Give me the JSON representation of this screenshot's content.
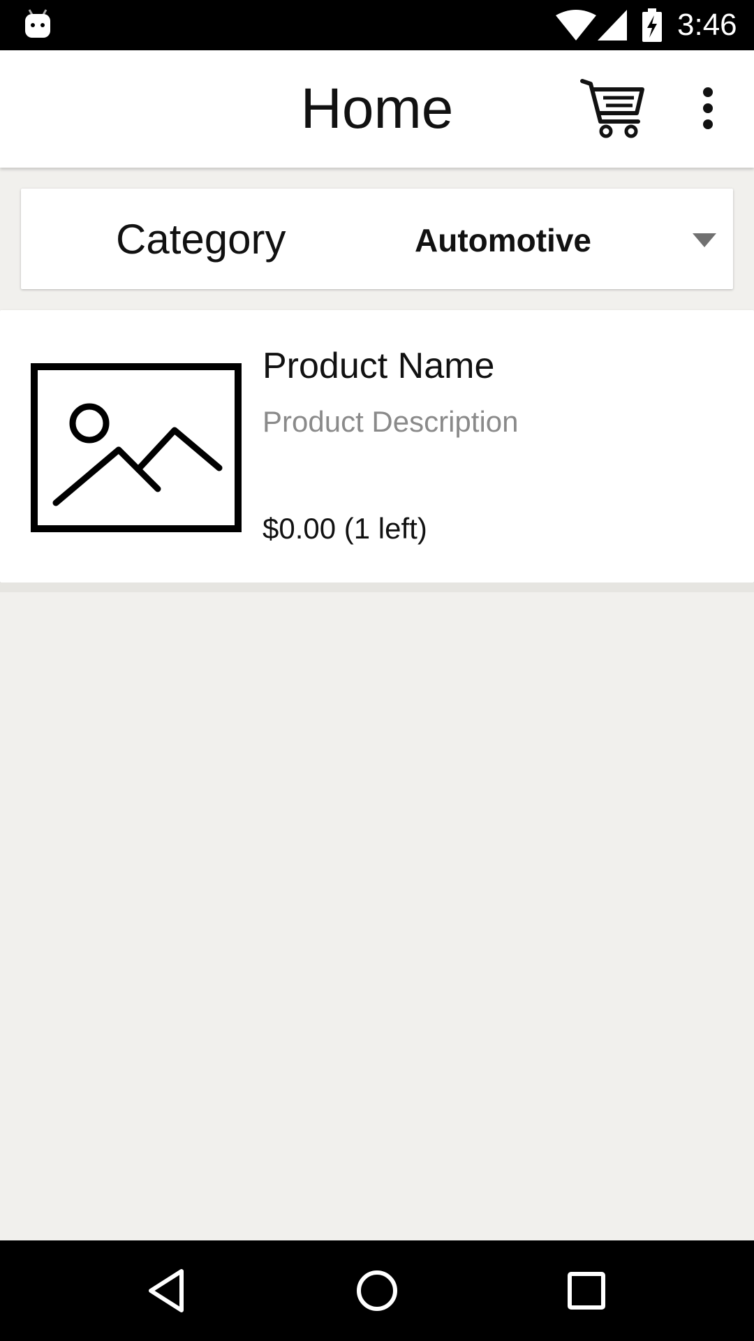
{
  "status_bar": {
    "time": "3:46",
    "icons": [
      "android-icon",
      "wifi-icon",
      "signal-icon",
      "battery-charging-icon"
    ]
  },
  "app_bar": {
    "title": "Home",
    "actions": [
      "cart-icon",
      "more-vert-icon"
    ]
  },
  "filter": {
    "label": "Category",
    "selected": "Automotive"
  },
  "products": [
    {
      "name": "Product Name",
      "description": "Product Description",
      "price": "$0.00",
      "stock": "(1 left)",
      "image_icon": "image-placeholder-icon"
    }
  ],
  "nav_bar": {
    "icons": [
      "back-icon",
      "home-icon",
      "recents-icon"
    ]
  },
  "colors": {
    "background": "#f1f0ed",
    "surface": "#ffffff",
    "system_bars": "#000000",
    "text_primary": "#111111",
    "text_secondary": "#8a8a8a"
  }
}
